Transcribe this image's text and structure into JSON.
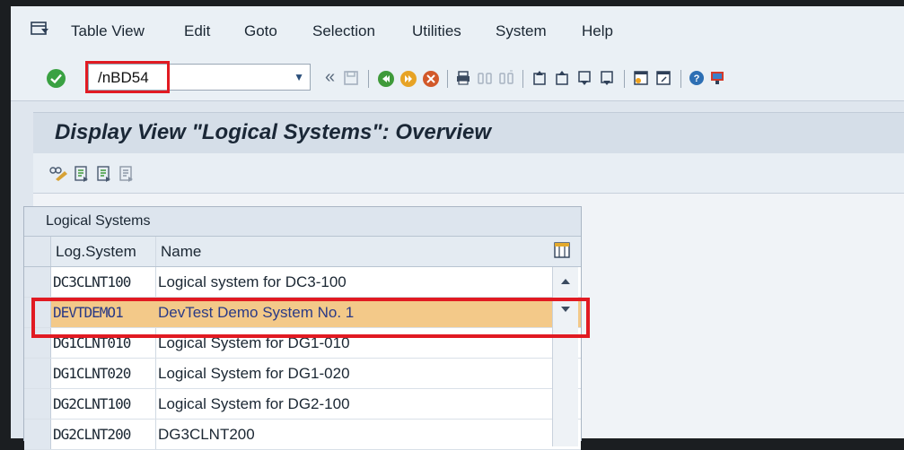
{
  "menu": {
    "items": [
      {
        "label": "Table View"
      },
      {
        "label": "Edit"
      },
      {
        "label": "Goto"
      },
      {
        "label": "Selection"
      },
      {
        "label": "Utilities"
      },
      {
        "label": "System"
      },
      {
        "label": "Help"
      }
    ]
  },
  "toolbar": {
    "command_value": "/nBD54",
    "back_chevron": "«"
  },
  "title": "Display View \"Logical Systems\": Overview",
  "table": {
    "caption": "Logical Systems",
    "columns": [
      "Log.System",
      "Name"
    ],
    "rows": [
      {
        "log_system": "DC3CLNT100",
        "name": "Logical system for DC3-100"
      },
      {
        "log_system": "DEVTDEMO1",
        "name": "DevTest Demo System No. 1"
      },
      {
        "log_system": "DG1CLNT010",
        "name": "Logical System for DG1-010"
      },
      {
        "log_system": "DG1CLNT020",
        "name": "Logical System for DG1-020"
      },
      {
        "log_system": "DG2CLNT100",
        "name": "Logical System for DG2-100"
      },
      {
        "log_system": "DG2CLNT200",
        "name": "DG3CLNT200"
      }
    ]
  },
  "colors": {
    "highlight_row": "#f3c989",
    "annotation_red": "#e11a22",
    "ok_green": "#3aa142"
  }
}
